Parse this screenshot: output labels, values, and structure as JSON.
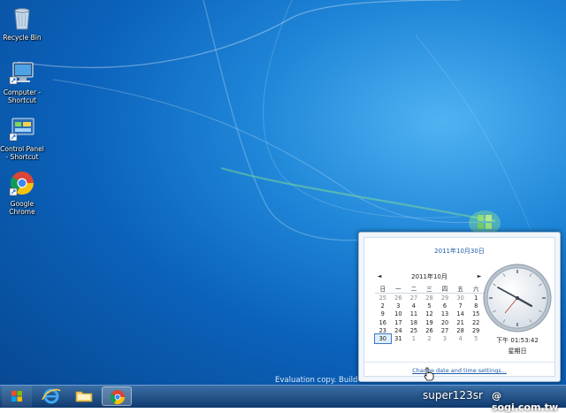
{
  "desktop_icons": [
    {
      "label": "Recycle Bin",
      "icon": "recycle-bin-icon"
    },
    {
      "label": "Computer - Shortcut",
      "icon": "computer-icon"
    },
    {
      "label": "Control Panel - Shortcut",
      "icon": "control-panel-icon"
    },
    {
      "label": "Google Chrome",
      "icon": "chrome-icon"
    }
  ],
  "watermark": "Evaluation copy. Build",
  "clock_flyout": {
    "date_header": "2011年10月30日",
    "month_label": "2011年10月",
    "weekdays": [
      "日",
      "一",
      "二",
      "三",
      "四",
      "五",
      "六"
    ],
    "weeks": [
      [
        "25",
        "26",
        "27",
        "28",
        "29",
        "30",
        "1"
      ],
      [
        "2",
        "3",
        "4",
        "5",
        "6",
        "7",
        "8"
      ],
      [
        "9",
        "10",
        "11",
        "12",
        "13",
        "14",
        "15"
      ],
      [
        "16",
        "17",
        "18",
        "19",
        "20",
        "21",
        "22"
      ],
      [
        "23",
        "24",
        "25",
        "26",
        "27",
        "28",
        "29"
      ],
      [
        "30",
        "31",
        "1",
        "2",
        "3",
        "4",
        "5"
      ]
    ],
    "today": "30",
    "time": "下午 01:53:42",
    "weekday_name": "星期日",
    "change_link": "Change date and time settings..."
  },
  "taskbar": {
    "items": [
      {
        "name": "internet-explorer",
        "icon": "ie-icon"
      },
      {
        "name": "windows-explorer",
        "icon": "folder-icon"
      },
      {
        "name": "google-chrome",
        "icon": "chrome-icon",
        "active": true
      }
    ],
    "tray_text": "super123sr",
    "brand": "@ sogi.com.tw"
  },
  "colors": {
    "accent": "#1d5aa8",
    "desktop": "#0b62bb"
  }
}
